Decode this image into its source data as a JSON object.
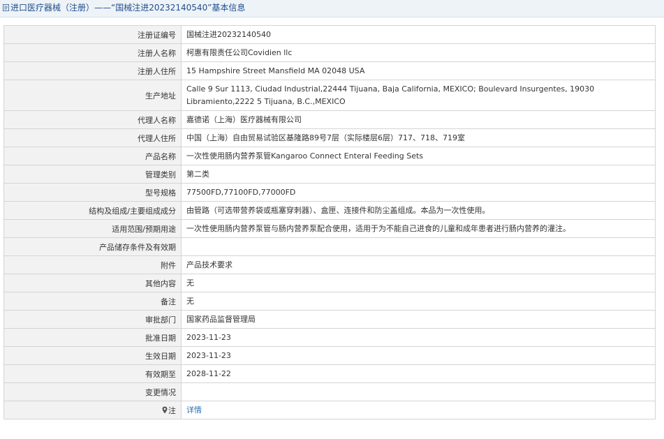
{
  "page": {
    "title": "进口医疗器械（注册）——“国械注进20232140540”基本信息"
  },
  "rows": [
    {
      "label": "注册证编号",
      "value": "国械注进20232140540"
    },
    {
      "label": "注册人名称",
      "value": "柯惠有限责任公司Covidien llc"
    },
    {
      "label": "注册人住所",
      "value": "15 Hampshire Street Mansfield MA 02048 USA"
    },
    {
      "label": "生产地址",
      "value": "Calle 9 Sur 1113, Ciudad Industrial,22444 Tijuana, Baja California, MEXICO; Boulevard Insurgentes, 19030 Libramiento,2222 5 Tijuana, B.C.,MEXICO"
    },
    {
      "label": "代理人名称",
      "value": "嘉德诺（上海）医疗器械有限公司"
    },
    {
      "label": "代理人住所",
      "value": "中国（上海）自由贸易试验区基隆路89号7层（实际楼层6层）717、718、719室"
    },
    {
      "label": "产品名称",
      "value": "一次性使用肠内营养泵管Kangaroo Connect Enteral Feeding Sets"
    },
    {
      "label": "管理类别",
      "value": "第二类"
    },
    {
      "label": "型号规格",
      "value": "77500FD,77100FD,77000FD"
    },
    {
      "label": "结构及组成/主要组成成分",
      "value": "由管路（可选带营养袋或瓶塞穿刺器）、盒匣、连接件和防尘盖组成。本品为一次性使用。"
    },
    {
      "label": "适用范围/预期用途",
      "value": "一次性使用肠内营养泵管与肠内营养泵配合使用，适用于为不能自己进食的儿童和成年患者进行肠内营养的灌注。"
    },
    {
      "label": "产品储存条件及有效期",
      "value": ""
    },
    {
      "label": "附件",
      "value": "产品技术要求"
    },
    {
      "label": "其他内容",
      "value": "无"
    },
    {
      "label": "备注",
      "value": "无"
    },
    {
      "label": "审批部门",
      "value": "国家药品监督管理局"
    },
    {
      "label": "批准日期",
      "value": "2023-11-23"
    },
    {
      "label": "生效日期",
      "value": "2023-11-23"
    },
    {
      "label": "有效期至",
      "value": "2028-11-22"
    },
    {
      "label": "变更情况",
      "value": ""
    }
  ],
  "note_row": {
    "label": "注",
    "link_text": "详情"
  },
  "icons": {
    "title": "document-icon",
    "note": "map-pin-icon"
  },
  "colors": {
    "title_text": "#1f4e8c",
    "link": "#2a6fb5",
    "label_bg": "#f2f2f2",
    "border": "#d4d4d4"
  }
}
